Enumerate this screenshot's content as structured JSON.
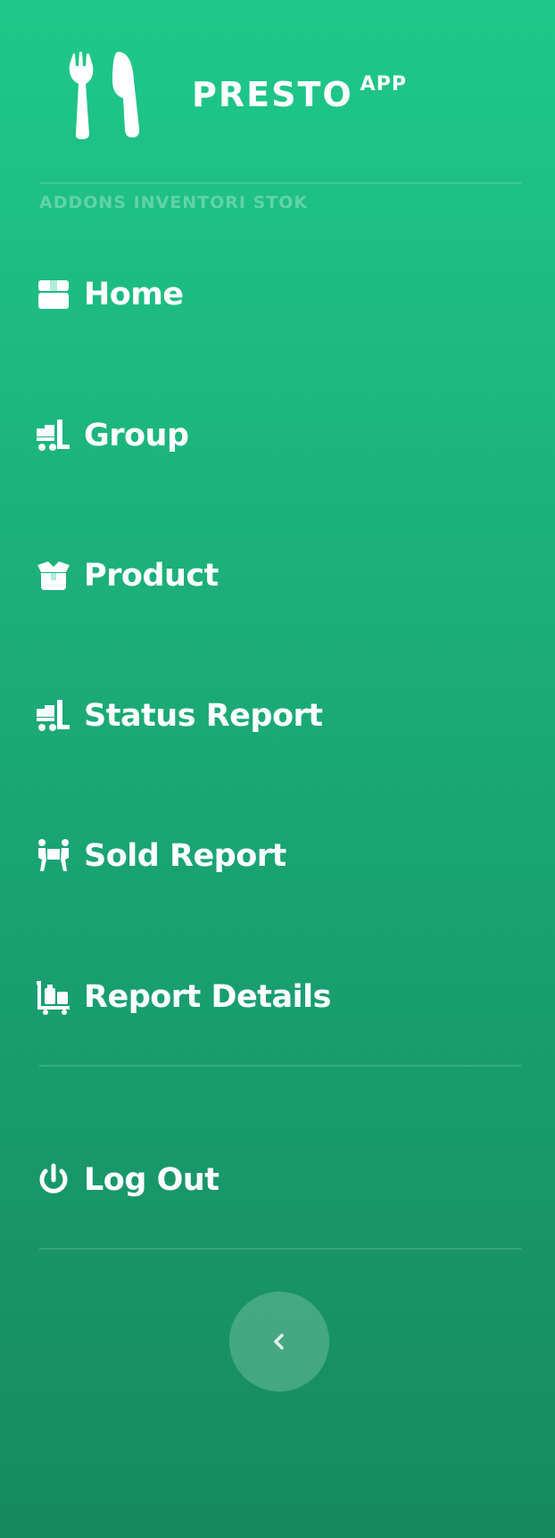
{
  "brand": {
    "name": "PRESTO",
    "superscript": "APP",
    "logo_icon": "fork-knife-icon"
  },
  "section_heading": "ADDONS INVENTORI STOK",
  "nav": [
    {
      "label": "Home",
      "icon": "box-icon"
    },
    {
      "label": "Group",
      "icon": "dolly-icon"
    },
    {
      "label": "Product",
      "icon": "open-box-icon"
    },
    {
      "label": "Status Report",
      "icon": "dolly-icon"
    },
    {
      "label": "Sold Report",
      "icon": "people-carry-icon"
    },
    {
      "label": "Report Details",
      "icon": "luggage-cart-icon"
    }
  ],
  "logout": {
    "label": "Log Out",
    "icon": "power-icon"
  },
  "collapse_toggle": {
    "icon": "chevron-left-icon"
  },
  "colors": {
    "sidebar_top": "#1fc88a",
    "sidebar_bottom": "#168a60",
    "text": "#ffffff"
  }
}
